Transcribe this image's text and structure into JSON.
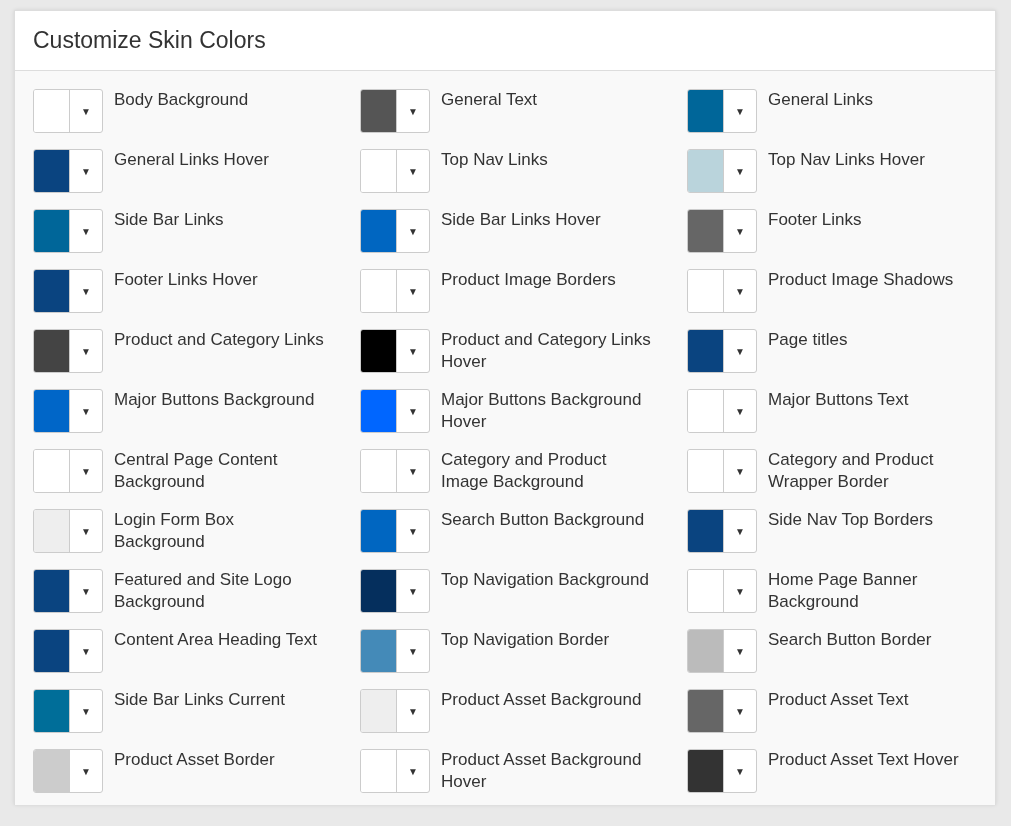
{
  "title": "Customize Skin Colors",
  "arrow": "▼",
  "settings": [
    {
      "label": "Body Background",
      "color": "#ffffff"
    },
    {
      "label": "General Text",
      "color": "#555555"
    },
    {
      "label": "General Links",
      "color": "#006699"
    },
    {
      "label": "General Links Hover",
      "color": "#0a4480"
    },
    {
      "label": "Top Nav Links",
      "color": "#ffffff"
    },
    {
      "label": "Top Nav Links Hover",
      "color": "#bad4dc"
    },
    {
      "label": "Side Bar Links",
      "color": "#006699"
    },
    {
      "label": "Side Bar Links Hover",
      "color": "#0066c1"
    },
    {
      "label": "Footer Links",
      "color": "#666666"
    },
    {
      "label": "Footer Links Hover",
      "color": "#0a4480"
    },
    {
      "label": "Product Image Borders",
      "color": "#ffffff"
    },
    {
      "label": "Product Image Shadows",
      "color": "#ffffff"
    },
    {
      "label": "Product and Category Links",
      "color": "#444444"
    },
    {
      "label": "Product and Category Links Hover",
      "color": "#000000"
    },
    {
      "label": "Page titles",
      "color": "#0a4480"
    },
    {
      "label": "Major Buttons Background",
      "color": "#0066c8"
    },
    {
      "label": "Major Buttons Background Hover",
      "color": "#0066ff"
    },
    {
      "label": "Major Buttons Text",
      "color": "#ffffff"
    },
    {
      "label": "Central Page Content Background",
      "color": "#ffffff"
    },
    {
      "label": "Category and Product Image Background",
      "color": "#ffffff"
    },
    {
      "label": "Category and Product Wrapper Border",
      "color": "#ffffff"
    },
    {
      "label": "Login Form Box Background",
      "color": "#eeeeee"
    },
    {
      "label": "Search Button Background",
      "color": "#0066c1"
    },
    {
      "label": "Side Nav Top Borders",
      "color": "#0a4480"
    },
    {
      "label": "Featured and Site Logo Background",
      "color": "#0a4480"
    },
    {
      "label": "Top Navigation Background",
      "color": "#052f5d"
    },
    {
      "label": "Home Page Banner Background",
      "color": "#ffffff"
    },
    {
      "label": "Content Area Heading Text",
      "color": "#0a4480"
    },
    {
      "label": "Top Navigation Border",
      "color": "#448ab8"
    },
    {
      "label": "Search Button Border",
      "color": "#bbbbbb"
    },
    {
      "label": "Side Bar Links Current",
      "color": "#006e99"
    },
    {
      "label": "Product Asset Background",
      "color": "#eeeeee"
    },
    {
      "label": "Product Asset Text",
      "color": "#666666"
    },
    {
      "label": "Product Asset Border",
      "color": "#cccccc"
    },
    {
      "label": "Product Asset Background Hover",
      "color": "#ffffff"
    },
    {
      "label": "Product Asset Text Hover",
      "color": "#333333"
    }
  ]
}
